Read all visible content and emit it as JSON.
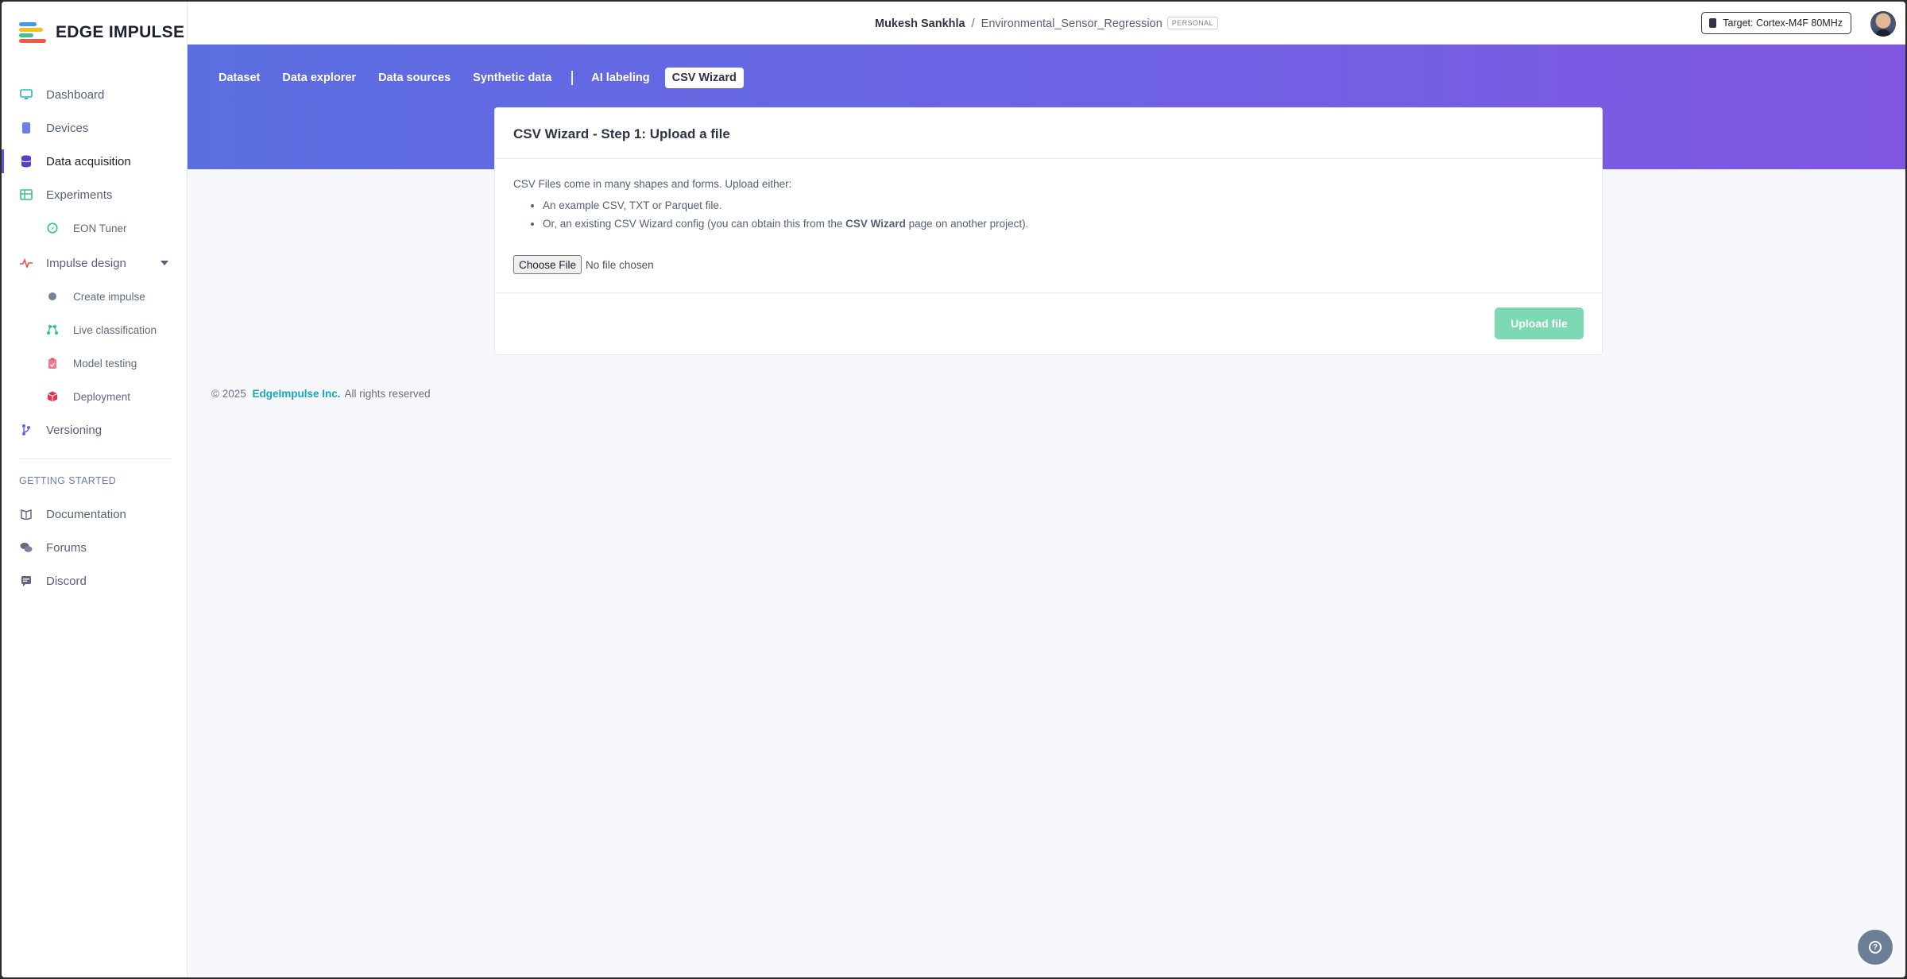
{
  "brand": {
    "name": "EDGE IMPULSE"
  },
  "header": {
    "user": "Mukesh Sankhla",
    "separator": "/",
    "project": "Environmental_Sensor_Regression",
    "badge": "PERSONAL",
    "target": "Target: Cortex-M4F 80MHz"
  },
  "sidebar": {
    "items": [
      {
        "label": "Dashboard",
        "icon": "monitor-icon"
      },
      {
        "label": "Devices",
        "icon": "device-icon"
      },
      {
        "label": "Data acquisition",
        "icon": "database-icon"
      },
      {
        "label": "Experiments",
        "icon": "grid-icon"
      },
      {
        "label": "EON Tuner",
        "icon": "tuner-icon"
      },
      {
        "label": "Impulse design",
        "icon": "pulse-icon"
      },
      {
        "label": "Create impulse",
        "icon": "dot-icon"
      },
      {
        "label": "Live classification",
        "icon": "network-icon"
      },
      {
        "label": "Model testing",
        "icon": "clipboard-icon"
      },
      {
        "label": "Deployment",
        "icon": "cube-icon"
      },
      {
        "label": "Versioning",
        "icon": "branch-icon"
      }
    ],
    "getting_started_title": "GETTING STARTED",
    "getting_started": [
      {
        "label": "Documentation",
        "icon": "book-icon"
      },
      {
        "label": "Forums",
        "icon": "chat-icon"
      },
      {
        "label": "Discord",
        "icon": "message-icon"
      }
    ]
  },
  "tabs": [
    {
      "label": "Dataset"
    },
    {
      "label": "Data explorer"
    },
    {
      "label": "Data sources"
    },
    {
      "label": "Synthetic data"
    },
    {
      "label": "AI labeling"
    },
    {
      "label": "CSV Wizard"
    }
  ],
  "card": {
    "title": "CSV Wizard - Step 1: Upload a file",
    "intro": "CSV Files come in many shapes and forms. Upload either:",
    "bullet1": "An example CSV, TXT or Parquet file.",
    "bullet2_pre": "Or, an existing CSV Wizard config (you can obtain this from the ",
    "bullet2_bold": "CSV Wizard",
    "bullet2_post": " page on another project).",
    "choose_file": "Choose File",
    "no_file": "No file chosen",
    "upload_button": "Upload file"
  },
  "footer": {
    "copyright": "© 2025",
    "company": "EdgeImpulse Inc.",
    "rights": "All rights reserved"
  },
  "colors": {
    "accent": "#5a55d9",
    "banner_start": "#5b6ee0",
    "banner_end": "#7f56e0",
    "upload_button": "#7cd9b4",
    "link": "#17a7c5"
  }
}
